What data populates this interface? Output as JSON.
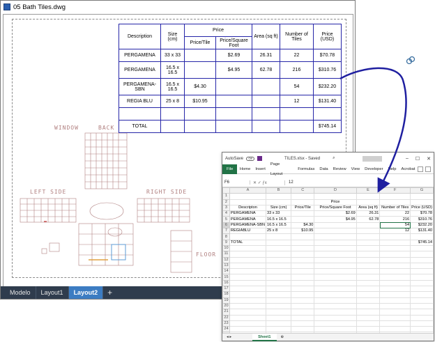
{
  "cad": {
    "title": "05 Bath Tiles.dwg",
    "tabs": [
      "Modelo",
      "Layout1",
      "Layout2"
    ],
    "active_tab": "Layout2",
    "add_tab": "+",
    "labels": {
      "window": "WINDOW",
      "back": "BACK",
      "left_side": "LEFT SIDE",
      "right_side": "RIGHT SIDE",
      "floor": "FLOOR"
    },
    "table": {
      "headers": {
        "description": "Description",
        "size": "Size (cm)",
        "price": "Price",
        "price_tile": "Price/Tile",
        "price_sqft": "Price/Square Foot",
        "area": "Area (sq ft)",
        "num_tiles": "Number of Tiles",
        "price_usd": "Price (USD)"
      },
      "rows": [
        {
          "description": "PERGAMENA",
          "size": "33 x 33",
          "price_tile": "",
          "price_sqft": "$2.69",
          "area": "26.31",
          "tiles": "22",
          "price": "$70.78"
        },
        {
          "description": "PERGAMENA",
          "size": "16.5 x 16.5",
          "price_tile": "",
          "price_sqft": "$4.95",
          "area": "62.78",
          "tiles": "216",
          "price": "$310.76"
        },
        {
          "description": "PERGAMENA-SBN",
          "size": "16.5 x 16.5",
          "price_tile": "$4.30",
          "price_sqft": "",
          "area": "",
          "tiles": "54",
          "price": "$232.20"
        },
        {
          "description": "REGIA BLU",
          "size": "25 x 8",
          "price_tile": "$10.95",
          "price_sqft": "",
          "area": "",
          "tiles": "12",
          "price": "$131.40"
        }
      ],
      "total_label": "TOTAL",
      "total_value": "$745.14"
    }
  },
  "excel": {
    "autosave": "AutoSave",
    "autosave_state": "Off",
    "title": "TILES.xlsx - Saved",
    "ribbon": [
      "File",
      "Home",
      "Insert",
      "Page Layout",
      "Formulas",
      "Data",
      "Review",
      "View",
      "Developer",
      "Help",
      "Acrobat"
    ],
    "name_box": "F6",
    "formula_value": "12",
    "columns": [
      "A",
      "B",
      "C",
      "D",
      "E",
      "F",
      "G"
    ],
    "rows": [
      [
        "",
        "",
        "",
        "",
        "",
        "",
        ""
      ],
      [
        "",
        "",
        "",
        "Price",
        "",
        "",
        ""
      ],
      [
        "Descripton",
        "Size (cm)",
        "Price/Tile",
        "Price/Square Foot",
        "Area (sq ft)",
        "Number of Tiles",
        "Price (USD)"
      ],
      [
        "PERGAMENA",
        "33 x 33",
        "",
        "$2.69",
        "26.31",
        "22",
        "$70.78"
      ],
      [
        "PERGAMENA",
        "16.5 x 16.5",
        "",
        "$4.95",
        "62.78",
        "216",
        "$310.76"
      ],
      [
        "PERGAMENA-SBN",
        "16.5 x 16.5",
        "$4.30",
        "",
        "",
        "54",
        "$232.20"
      ],
      [
        "REGIABLU",
        "25 x 8",
        "$10.95",
        "",
        "",
        "12",
        "$131.40"
      ],
      [
        "",
        "",
        "",
        "",
        "",
        "",
        ""
      ],
      [
        "TOTAL",
        "",
        "",
        "",
        "",
        "",
        "$745.14"
      ]
    ],
    "sheet_tab": "Sheet1"
  }
}
